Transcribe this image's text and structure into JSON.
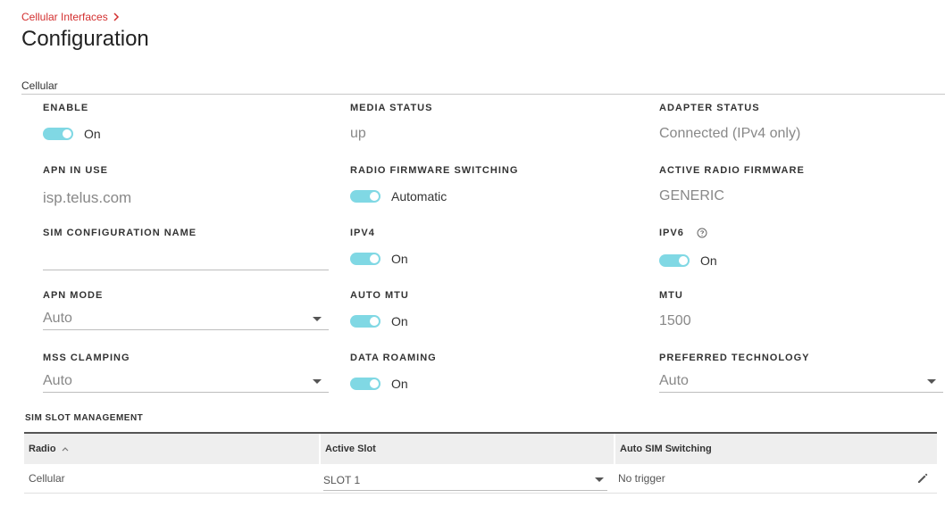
{
  "breadcrumb": {
    "label": "Cellular Interfaces"
  },
  "page": {
    "title": "Configuration"
  },
  "section": {
    "label": "Cellular"
  },
  "fields": {
    "enable": {
      "label": "ENABLE",
      "value": "On"
    },
    "media_status": {
      "label": "MEDIA STATUS",
      "value": "up"
    },
    "adapter_status": {
      "label": "ADAPTER STATUS",
      "value": "Connected (IPv4 only)"
    },
    "apn_in_use": {
      "label": "APN IN USE",
      "value": "isp.telus.com"
    },
    "radio_firmware_switching": {
      "label": "RADIO FIRMWARE SWITCHING",
      "value": "Automatic"
    },
    "active_radio_firmware": {
      "label": "ACTIVE RADIO FIRMWARE",
      "value": "GENERIC"
    },
    "sim_configuration_name": {
      "label": "SIM CONFIGURATION NAME",
      "value": ""
    },
    "ipv4": {
      "label": "IPV4",
      "value": "On"
    },
    "ipv6": {
      "label": "IPV6",
      "value": "On"
    },
    "apn_mode": {
      "label": "APN MODE",
      "value": "Auto"
    },
    "auto_mtu": {
      "label": "AUTO MTU",
      "value": "On"
    },
    "mtu": {
      "label": "MTU",
      "value": "1500"
    },
    "mss_clamping": {
      "label": "MSS CLAMPING",
      "value": "Auto"
    },
    "data_roaming": {
      "label": "DATA ROAMING",
      "value": "On"
    },
    "preferred_technology": {
      "label": "PREFERRED TECHNOLOGY",
      "value": "Auto"
    }
  },
  "sim_slot": {
    "label": "SIM SLOT MANAGEMENT",
    "columns": [
      "Radio",
      "Active Slot",
      "Auto SIM Switching"
    ],
    "rows": [
      {
        "radio": "Cellular",
        "active_slot": "SLOT 1",
        "auto_sim_switching": "No trigger"
      }
    ]
  },
  "colors": {
    "accent": "#80d8e4",
    "breadcrumb": "#d32f2f"
  },
  "icons": {
    "breadcrumb": "chevron-right-icon",
    "help": "help-circle-icon",
    "sort": "sort-up-icon",
    "edit": "pencil-icon",
    "dropdown": "caret-down-icon"
  }
}
